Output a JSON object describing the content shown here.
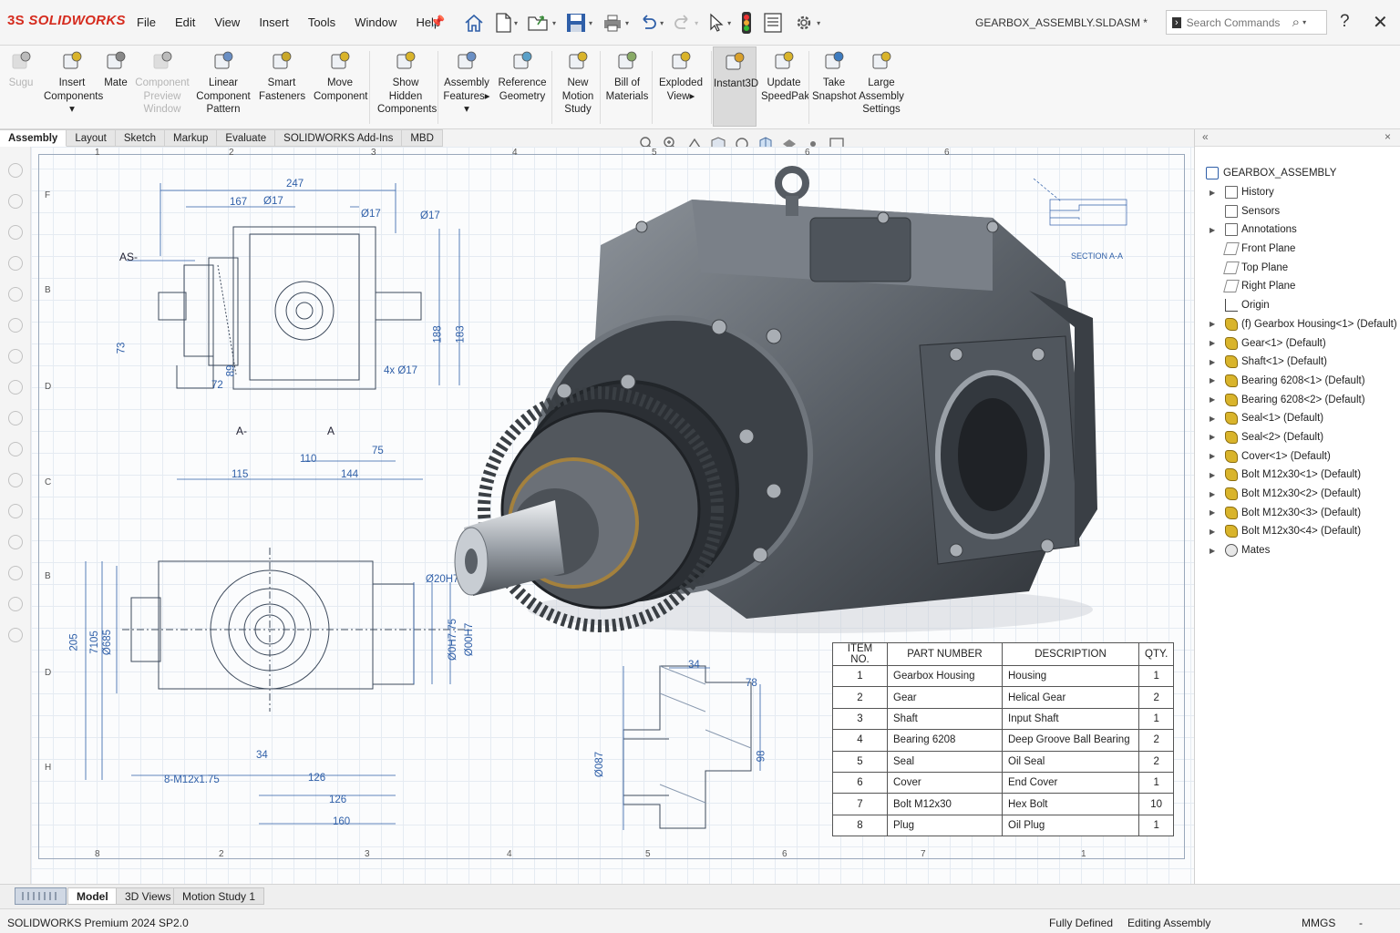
{
  "app": {
    "logo": "SOLIDWORKS",
    "doc_title": "GEARBOX_ASSEMBLY.SLDASM *"
  },
  "menu": [
    "File",
    "Edit",
    "View",
    "Insert",
    "Tools",
    "Window",
    "Help"
  ],
  "search": {
    "placeholder": "Search Commands"
  },
  "ribbon": {
    "buttons": [
      {
        "id": "sheet",
        "lines": [
          "Sugu"
        ],
        "disabled": true
      },
      {
        "id": "insert-components",
        "lines": [
          "Insert",
          "Components",
          "▾"
        ]
      },
      {
        "id": "mate",
        "lines": [
          "Mate"
        ]
      },
      {
        "id": "component-preview-window",
        "lines": [
          "Component",
          "Preview",
          "Window"
        ],
        "disabled": true
      },
      {
        "id": "linear-component-pattern",
        "lines": [
          "Linear",
          "Component",
          "Pattern"
        ]
      },
      {
        "id": "smart-fasteners",
        "lines": [
          "Smart",
          "Fasteners"
        ]
      },
      {
        "id": "move-component",
        "lines": [
          "Move",
          "Component"
        ]
      },
      {
        "id": "show-hidden-components",
        "lines": [
          "Show",
          "Hidden",
          "Components"
        ]
      },
      {
        "id": "assembly-features",
        "lines": [
          "Assembly",
          "Features▸",
          "▾"
        ]
      },
      {
        "id": "reference-geometry",
        "lines": [
          "Reference",
          "Geometry"
        ]
      },
      {
        "id": "new-motion-study",
        "lines": [
          "New",
          "Motion",
          "Study"
        ]
      },
      {
        "id": "bill-of-materials",
        "lines": [
          "Bill of",
          "Materials"
        ]
      },
      {
        "id": "exploded-view",
        "lines": [
          "Exploded",
          "View▸"
        ]
      },
      {
        "id": "instant3d",
        "lines": [
          "Instant3D"
        ],
        "active": true
      },
      {
        "id": "update-speedpak",
        "lines": [
          "Update",
          "SpeedPak"
        ]
      },
      {
        "id": "take-snapshot",
        "lines": [
          "Take",
          "Snapshot"
        ]
      },
      {
        "id": "large-assembly-settings",
        "lines": [
          "Large",
          "Assembly",
          "Settings"
        ]
      }
    ]
  },
  "tabs": [
    "Assembly",
    "Layout",
    "Sketch",
    "Markup",
    "Evaluate",
    "SOLIDWORKS Add-Ins",
    "MBD"
  ],
  "active_tab": "Assembly",
  "drawing": {
    "zone_top": [
      "1",
      "2",
      "3",
      "4",
      "5",
      "6",
      "6"
    ],
    "zone_bottom": [
      "8",
      "2",
      "3",
      "4",
      "5",
      "6",
      "7",
      "1"
    ],
    "zone_left": [
      "F",
      "B",
      "D",
      "C",
      "B",
      "D",
      "H"
    ],
    "view1_dims": [
      "247",
      "167",
      "Ø17",
      "Ø17",
      "Ø17",
      "73",
      "72",
      "89",
      "188",
      "183",
      "4x Ø17",
      "110",
      "75",
      "115",
      "144"
    ],
    "view1_labels": [
      "AS-",
      "A-",
      "A"
    ],
    "view2_dims": [
      "Ø20H7",
      "205",
      "7105",
      "Ø685",
      "Ø0H7.75",
      "Ø00H7",
      "8-M12x1.75",
      "126",
      "126",
      "160",
      "34"
    ],
    "view3_dims": [
      "34",
      "78",
      "Ø087",
      "98"
    ],
    "section_label": "SECTION A-A"
  },
  "bom": {
    "headers": [
      "ITEM NO.",
      "PART NUMBER",
      "DESCRIPTION",
      "QTY."
    ],
    "rows": [
      [
        "1",
        "Gearbox Housing",
        "Housing",
        "1"
      ],
      [
        "2",
        "Gear",
        "Helical Gear",
        "2"
      ],
      [
        "3",
        "Shaft",
        "Input Shaft",
        "1"
      ],
      [
        "4",
        "Bearing 6208",
        "Deep Groove Ball Bearing",
        "2"
      ],
      [
        "5",
        "Seal",
        "Oil Seal",
        "2"
      ],
      [
        "6",
        "Cover",
        "End Cover",
        "1"
      ],
      [
        "7",
        "Bolt M12x30",
        "Hex Bolt",
        "10"
      ],
      [
        "8",
        "Plug",
        "Oil Plug",
        "1"
      ]
    ]
  },
  "tree": {
    "panel_controls": [
      "«",
      "×"
    ],
    "root": "GEARBOX_ASSEMBLY",
    "items": [
      {
        "label": "History",
        "icon": "folder",
        "exp": true
      },
      {
        "label": "Sensors",
        "icon": "folder",
        "exp": false
      },
      {
        "label": "Annotations",
        "icon": "folder",
        "exp": true
      },
      {
        "label": "Front Plane",
        "icon": "plane",
        "exp": false
      },
      {
        "label": "Top Plane",
        "icon": "plane",
        "exp": false
      },
      {
        "label": "Right Plane",
        "icon": "plane",
        "exp": false
      },
      {
        "label": "Origin",
        "icon": "origin",
        "exp": false
      },
      {
        "label": "(f) Gearbox Housing<1> (Default)",
        "icon": "part",
        "exp": true
      },
      {
        "label": "Gear<1> (Default)",
        "icon": "part",
        "exp": true
      },
      {
        "label": "Shaft<1> (Default)",
        "icon": "part",
        "exp": true
      },
      {
        "label": "Bearing 6208<1> (Default)",
        "icon": "part",
        "exp": true
      },
      {
        "label": "Bearing 6208<2> (Default)",
        "icon": "part",
        "exp": true
      },
      {
        "label": "Seal<1> (Default)",
        "icon": "part",
        "exp": true
      },
      {
        "label": "Seal<2> (Default)",
        "icon": "part",
        "exp": true
      },
      {
        "label": "Cover<1> (Default)",
        "icon": "part",
        "exp": true
      },
      {
        "label": "Bolt M12x30<1> (Default)",
        "icon": "part",
        "exp": true
      },
      {
        "label": "Bolt M12x30<2> (Default)",
        "icon": "part",
        "exp": true
      },
      {
        "label": "Bolt M12x30<3> (Default)",
        "icon": "part",
        "exp": true
      },
      {
        "label": "Bolt M12x30<4> (Default)",
        "icon": "part",
        "exp": true
      },
      {
        "label": "Mates",
        "icon": "mates",
        "exp": true
      }
    ]
  },
  "bottom_tabs": [
    "Model",
    "3D Views",
    "Motion Study 1"
  ],
  "status": {
    "version": "SOLIDWORKS Premium 2024 SP2.0",
    "state": "Fully Defined",
    "mode": "Editing Assembly",
    "units": "MMGS",
    "units_arrow": "-"
  },
  "colors": {
    "brand": "#d52b1e",
    "dim_blue": "#2f5fa8",
    "part_gold": "#d9b42b"
  }
}
